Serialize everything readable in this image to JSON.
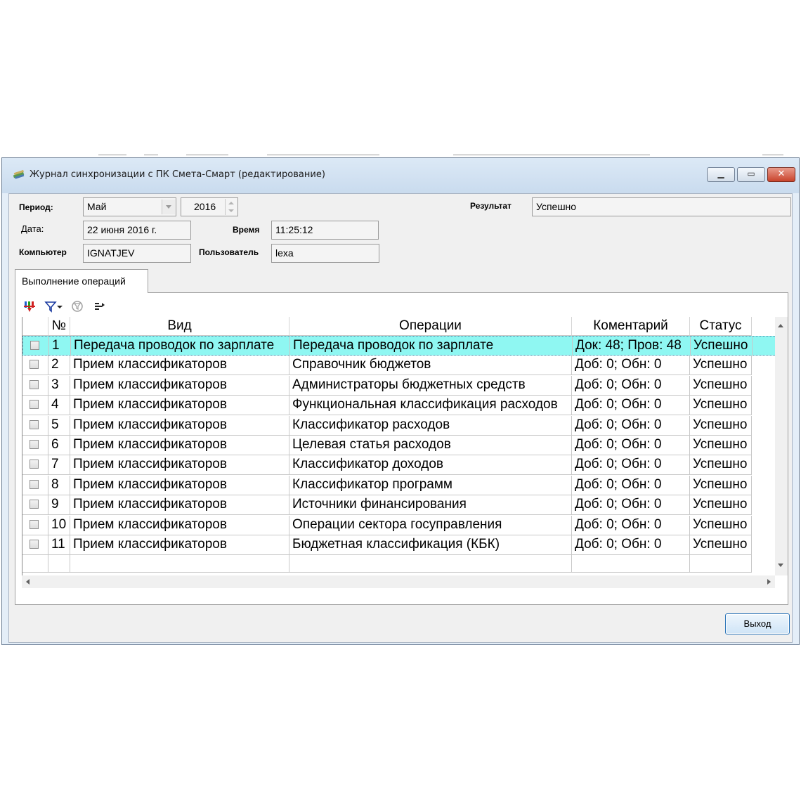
{
  "window": {
    "title": "Журнал синхронизации с ПК Смета-Смарт (редактирование)",
    "icon": "books-icon",
    "controls": {
      "minimize": "minimize-icon",
      "maximize": "maximize-icon",
      "close": "close-icon"
    }
  },
  "form": {
    "period_label": "Период:",
    "period_month": "Май",
    "period_year": "2016",
    "date_label": "Дата:",
    "date_value": "22 июня 2016 г.",
    "time_label": "Время",
    "time_value": "11:25:12",
    "computer_label": "Компьютер",
    "computer_value": "IGNATJEV",
    "user_label": "Пользователь",
    "user_value": "lexa",
    "result_label": "Результат",
    "result_value": "Успешно"
  },
  "tabs": [
    {
      "label": "Выполнение операций"
    }
  ],
  "toolbar": {
    "icons": [
      "sort-colors-icon",
      "filter-icon",
      "dropdown-arrow-icon",
      "clear-filter-icon",
      "columns-icon"
    ]
  },
  "grid": {
    "columns": [
      "№",
      "Вид",
      "Операции",
      "Коментарий",
      "Статус"
    ],
    "rows": [
      {
        "n": "1",
        "type": "Передача проводок по зарплате",
        "op": "Передача проводок по зарплате",
        "comment": "Док: 48; Пров: 48",
        "status": "Успешно"
      },
      {
        "n": "2",
        "type": "Прием классификаторов",
        "op": "Справочник бюджетов",
        "comment": "Доб: 0; Обн: 0",
        "status": "Успешно"
      },
      {
        "n": "3",
        "type": "Прием классификаторов",
        "op": "Администраторы бюджетных средств",
        "comment": "Доб: 0; Обн: 0",
        "status": "Успешно"
      },
      {
        "n": "4",
        "type": "Прием классификаторов",
        "op": "Функциональная классификация расходов",
        "comment": "Доб: 0; Обн: 0",
        "status": "Успешно"
      },
      {
        "n": "5",
        "type": "Прием классификаторов",
        "op": "Классификатор расходов",
        "comment": "Доб: 0; Обн: 0",
        "status": "Успешно"
      },
      {
        "n": "6",
        "type": "Прием классификаторов",
        "op": "Целевая статья расходов",
        "comment": "Доб: 0; Обн: 0",
        "status": "Успешно"
      },
      {
        "n": "7",
        "type": "Прием классификаторов",
        "op": "Классификатор доходов",
        "comment": "Доб: 0; Обн: 0",
        "status": "Успешно"
      },
      {
        "n": "8",
        "type": "Прием классификаторов",
        "op": "Классификатор программ",
        "comment": "Доб: 0; Обн: 0",
        "status": "Успешно"
      },
      {
        "n": "9",
        "type": "Прием классификаторов",
        "op": "Источники финансирования",
        "comment": "Доб: 0; Обн: 0",
        "status": "Успешно"
      },
      {
        "n": "10",
        "type": "Прием классификаторов",
        "op": "Операции сектора госуправления",
        "comment": "Доб: 0; Обн: 0",
        "status": "Успешно"
      },
      {
        "n": "11",
        "type": "Прием классификаторов",
        "op": "Бюджетная классификация (КБК)",
        "comment": "Доб: 0; Обн: 0",
        "status": "Успешно"
      }
    ]
  },
  "buttons": {
    "exit_label": "Выход"
  },
  "colors": {
    "selected_row": "#8ff7f2",
    "window_frame": "#6d7f96"
  }
}
